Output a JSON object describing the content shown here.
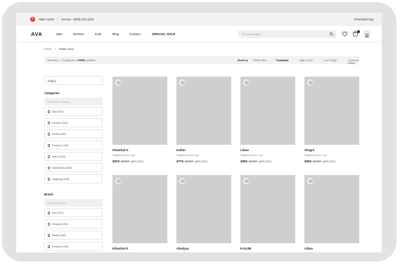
{
  "topbar": {
    "help_label": "Help Center",
    "separator": "|",
    "service_label": "Service - (828) 222-4242",
    "download_label": "Download App"
  },
  "header": {
    "logo": "AVA",
    "nav": [
      "Men",
      "Women",
      "Kids",
      "Blog",
      "Contact",
      "SPECIAL SALE"
    ],
    "search_placeholder": "Sto una fill daily",
    "cart_count": "2",
    "icons": [
      "search-icon",
      "heart-icon",
      "cart-icon",
      "user-icon"
    ]
  },
  "breadcrumb": [
    "Home",
    ">",
    "Ethnic wear"
  ],
  "sortbar": {
    "showing_prefix": "Showing 1 - 17 products of ",
    "showing_total": "28280",
    "showing_suffix": " products",
    "sort_label": "Short by",
    "options": [
      "What's New",
      "Popularity",
      "High to Low",
      "Low to High",
      "Customer Rating"
    ],
    "active_option": "Popularity"
  },
  "filters": {
    "title": "Filters",
    "categories_label": "Categories",
    "categories_search_placeholder": "Search for Category",
    "categories": [
      "Tops (337)",
      "Dresses (246)",
      "Tshirts (308)",
      "Trousers (145)",
      "Jeans (149)",
      "Sweatshirts (308)",
      "Leggings (498)"
    ],
    "brand_label": "Brand",
    "brand_search_placeholder": "Search for Brand",
    "brands": [
      "Tops (337)",
      "Dresses (246)",
      "Tshirts (308)",
      "Trousers (145)"
    ]
  },
  "products": [
    {
      "brand": "Khushal K",
      "desc": "Striped A-Line Top",
      "price": "$879",
      "mrp": "$1599",
      "off": "(45% OFF)"
    },
    {
      "brand": "Kulini",
      "desc": "Striped A-Line Top",
      "price": "$779",
      "mrp": "$1599",
      "off": "(45% OFF)"
    },
    {
      "brand": "Libas",
      "desc": "Striped A-Line Top",
      "price": "$999",
      "mrp": "$1599",
      "off": "(45% OFF)"
    },
    {
      "brand": "Singni",
      "desc": "Striped A-Line Top",
      "price": "$509",
      "mrp": "$1599",
      "off": "(45% OFF)"
    },
    {
      "brand": "Khushal K",
      "desc": "",
      "price": "",
      "mrp": "",
      "off": ""
    },
    {
      "brand": "Ahalyaa",
      "desc": "",
      "price": "",
      "mrp": "",
      "off": ""
    },
    {
      "brand": "KALINI",
      "desc": "",
      "price": "",
      "mrp": "",
      "off": ""
    },
    {
      "brand": "Libas",
      "desc": "",
      "price": "",
      "mrp": "",
      "off": ""
    }
  ],
  "colors": {
    "accent": "#e53935",
    "placeholder_image": "#cfcfcf",
    "frame": "#e2e2e2"
  }
}
